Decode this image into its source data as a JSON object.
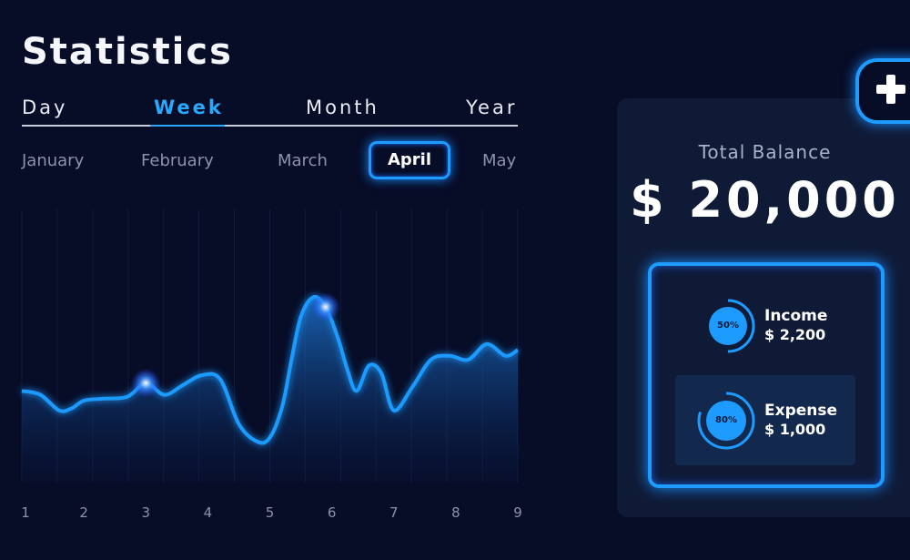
{
  "title": "Statistics",
  "periods": [
    "Day",
    "Week",
    "Month",
    "Year"
  ],
  "active_period": "Week",
  "months": [
    "January",
    "February",
    "March",
    "April",
    "May"
  ],
  "active_month": "April",
  "chart_data": {
    "type": "area",
    "x": [
      1,
      2,
      3,
      4,
      5,
      6,
      7,
      8,
      9
    ],
    "xticks": [
      "1",
      "2",
      "3",
      "4",
      "5",
      "6",
      "7",
      "8",
      "9"
    ],
    "series": [
      {
        "x": [
          1,
          1.3,
          1.6,
          1.8,
          2.0,
          2.3,
          2.7,
          3.0,
          3.3,
          3.6,
          3.9,
          4.2,
          4.5,
          4.8,
          5.0,
          5.2,
          5.35,
          5.5,
          5.7,
          5.9,
          6.1,
          6.25,
          6.4,
          6.6,
          6.8,
          7.0,
          7.3,
          7.6,
          7.9,
          8.2,
          8.5,
          8.8,
          9.0
        ],
        "y": [
          47,
          45,
          37,
          38,
          42,
          43,
          44,
          51,
          45,
          50,
          55,
          53,
          30,
          21,
          23,
          39,
          63,
          85,
          95,
          90,
          74,
          58,
          47,
          60,
          56,
          37,
          49,
          63,
          65,
          63,
          71,
          65,
          68
        ]
      }
    ],
    "ylim": [
      0,
      140
    ],
    "xlim": [
      1,
      9
    ],
    "highlights": [
      3,
      5.9
    ],
    "grid": true,
    "line_color": "#1e9bff"
  },
  "balance": {
    "label": "Total Balance",
    "value": "$ 20,000"
  },
  "income": {
    "label": "Income",
    "value": "$ 2,200",
    "percent_label": "50%",
    "percent": 50
  },
  "expense": {
    "label": "Expense",
    "value": "$ 1,000",
    "percent_label": "80%",
    "percent": 80
  },
  "colors": {
    "background": "#070c27",
    "accent": "#1e9bff",
    "card": "#0f1a36",
    "muted_text": "#8b93ad"
  },
  "icons": {
    "add": "plus-icon"
  }
}
